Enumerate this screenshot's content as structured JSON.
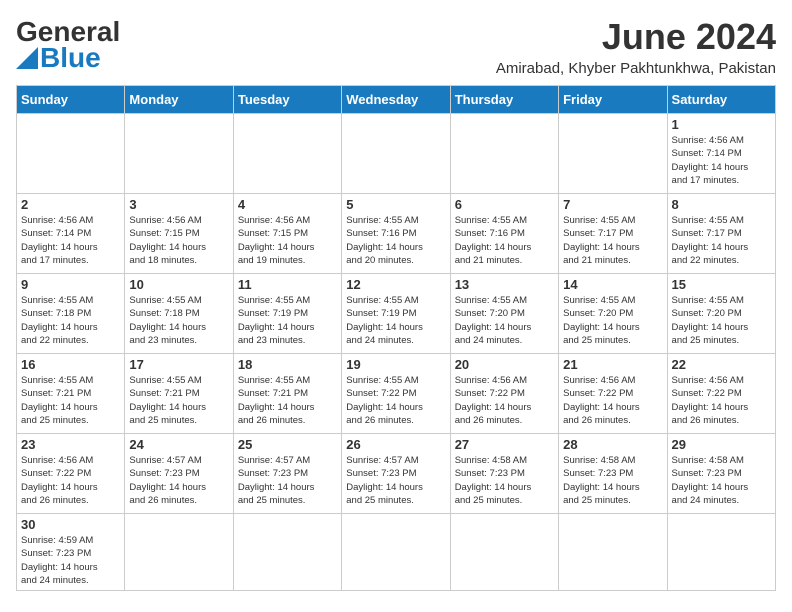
{
  "header": {
    "logo_general": "General",
    "logo_blue": "Blue",
    "month_title": "June 2024",
    "subtitle": "Amirabad, Khyber Pakhtunkhwa, Pakistan"
  },
  "days_of_week": [
    "Sunday",
    "Monday",
    "Tuesday",
    "Wednesday",
    "Thursday",
    "Friday",
    "Saturday"
  ],
  "weeks": [
    [
      {
        "day": "",
        "info": ""
      },
      {
        "day": "",
        "info": ""
      },
      {
        "day": "",
        "info": ""
      },
      {
        "day": "",
        "info": ""
      },
      {
        "day": "",
        "info": ""
      },
      {
        "day": "",
        "info": ""
      },
      {
        "day": "1",
        "info": "Sunrise: 4:56 AM\nSunset: 7:14 PM\nDaylight: 14 hours\nand 17 minutes."
      }
    ],
    [
      {
        "day": "2",
        "info": "Sunrise: 4:56 AM\nSunset: 7:14 PM\nDaylight: 14 hours\nand 17 minutes."
      },
      {
        "day": "3",
        "info": "Sunrise: 4:56 AM\nSunset: 7:15 PM\nDaylight: 14 hours\nand 18 minutes."
      },
      {
        "day": "4",
        "info": "Sunrise: 4:56 AM\nSunset: 7:15 PM\nDaylight: 14 hours\nand 19 minutes."
      },
      {
        "day": "5",
        "info": "Sunrise: 4:55 AM\nSunset: 7:16 PM\nDaylight: 14 hours\nand 20 minutes."
      },
      {
        "day": "6",
        "info": "Sunrise: 4:55 AM\nSunset: 7:16 PM\nDaylight: 14 hours\nand 21 minutes."
      },
      {
        "day": "7",
        "info": "Sunrise: 4:55 AM\nSunset: 7:17 PM\nDaylight: 14 hours\nand 21 minutes."
      },
      {
        "day": "8",
        "info": "Sunrise: 4:55 AM\nSunset: 7:17 PM\nDaylight: 14 hours\nand 22 minutes."
      }
    ],
    [
      {
        "day": "9",
        "info": "Sunrise: 4:55 AM\nSunset: 7:18 PM\nDaylight: 14 hours\nand 22 minutes."
      },
      {
        "day": "10",
        "info": "Sunrise: 4:55 AM\nSunset: 7:18 PM\nDaylight: 14 hours\nand 23 minutes."
      },
      {
        "day": "11",
        "info": "Sunrise: 4:55 AM\nSunset: 7:19 PM\nDaylight: 14 hours\nand 23 minutes."
      },
      {
        "day": "12",
        "info": "Sunrise: 4:55 AM\nSunset: 7:19 PM\nDaylight: 14 hours\nand 24 minutes."
      },
      {
        "day": "13",
        "info": "Sunrise: 4:55 AM\nSunset: 7:20 PM\nDaylight: 14 hours\nand 24 minutes."
      },
      {
        "day": "14",
        "info": "Sunrise: 4:55 AM\nSunset: 7:20 PM\nDaylight: 14 hours\nand 25 minutes."
      },
      {
        "day": "15",
        "info": "Sunrise: 4:55 AM\nSunset: 7:20 PM\nDaylight: 14 hours\nand 25 minutes."
      }
    ],
    [
      {
        "day": "16",
        "info": "Sunrise: 4:55 AM\nSunset: 7:21 PM\nDaylight: 14 hours\nand 25 minutes."
      },
      {
        "day": "17",
        "info": "Sunrise: 4:55 AM\nSunset: 7:21 PM\nDaylight: 14 hours\nand 25 minutes."
      },
      {
        "day": "18",
        "info": "Sunrise: 4:55 AM\nSunset: 7:21 PM\nDaylight: 14 hours\nand 26 minutes."
      },
      {
        "day": "19",
        "info": "Sunrise: 4:55 AM\nSunset: 7:22 PM\nDaylight: 14 hours\nand 26 minutes."
      },
      {
        "day": "20",
        "info": "Sunrise: 4:56 AM\nSunset: 7:22 PM\nDaylight: 14 hours\nand 26 minutes."
      },
      {
        "day": "21",
        "info": "Sunrise: 4:56 AM\nSunset: 7:22 PM\nDaylight: 14 hours\nand 26 minutes."
      },
      {
        "day": "22",
        "info": "Sunrise: 4:56 AM\nSunset: 7:22 PM\nDaylight: 14 hours\nand 26 minutes."
      }
    ],
    [
      {
        "day": "23",
        "info": "Sunrise: 4:56 AM\nSunset: 7:22 PM\nDaylight: 14 hours\nand 26 minutes."
      },
      {
        "day": "24",
        "info": "Sunrise: 4:57 AM\nSunset: 7:23 PM\nDaylight: 14 hours\nand 26 minutes."
      },
      {
        "day": "25",
        "info": "Sunrise: 4:57 AM\nSunset: 7:23 PM\nDaylight: 14 hours\nand 25 minutes."
      },
      {
        "day": "26",
        "info": "Sunrise: 4:57 AM\nSunset: 7:23 PM\nDaylight: 14 hours\nand 25 minutes."
      },
      {
        "day": "27",
        "info": "Sunrise: 4:58 AM\nSunset: 7:23 PM\nDaylight: 14 hours\nand 25 minutes."
      },
      {
        "day": "28",
        "info": "Sunrise: 4:58 AM\nSunset: 7:23 PM\nDaylight: 14 hours\nand 25 minutes."
      },
      {
        "day": "29",
        "info": "Sunrise: 4:58 AM\nSunset: 7:23 PM\nDaylight: 14 hours\nand 24 minutes."
      }
    ],
    [
      {
        "day": "30",
        "info": "Sunrise: 4:59 AM\nSunset: 7:23 PM\nDaylight: 14 hours\nand 24 minutes."
      },
      {
        "day": "",
        "info": ""
      },
      {
        "day": "",
        "info": ""
      },
      {
        "day": "",
        "info": ""
      },
      {
        "day": "",
        "info": ""
      },
      {
        "day": "",
        "info": ""
      },
      {
        "day": "",
        "info": ""
      }
    ]
  ]
}
